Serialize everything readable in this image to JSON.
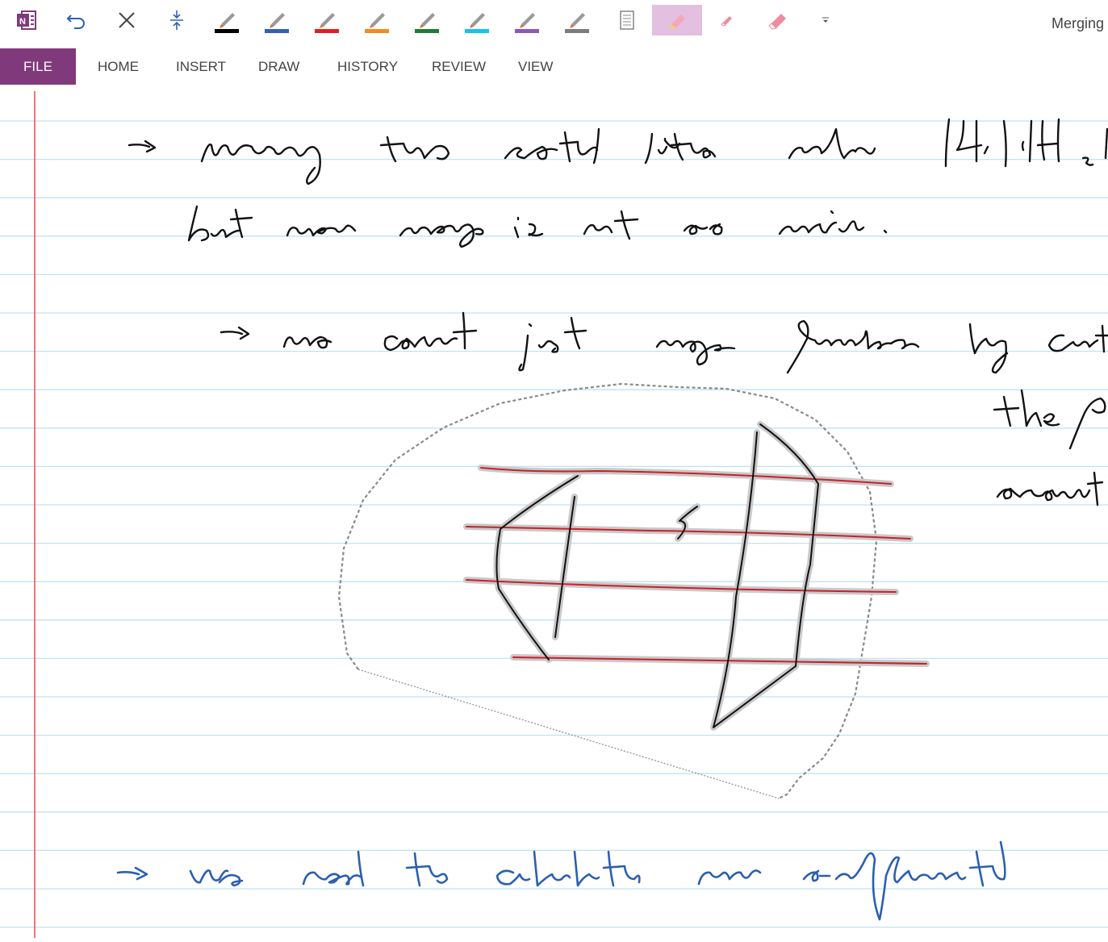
{
  "app": {
    "title": "Merging"
  },
  "quick_access": {
    "icons": [
      "onenote-logo-icon",
      "undo-icon",
      "lasso-delete-icon",
      "insert-space-icon",
      "pen-black-icon",
      "pen-blue-icon",
      "pen-red-icon",
      "pen-orange-icon",
      "pen-green-icon",
      "pen-cyan-icon",
      "pen-purple-icon",
      "pen-gray-icon",
      "page-icon",
      "highlighter-pink-icon",
      "eraser-small-icon",
      "eraser-large-icon",
      "customize-dropdown-icon"
    ],
    "pen_colors": [
      "#000000",
      "#2e62b4",
      "#e02020",
      "#f28c1c",
      "#1e7d36",
      "#12c4ef",
      "#8e56c0",
      "#7c7c7c"
    ],
    "active_tool": "highlighter-pink"
  },
  "ribbon": {
    "file_tab": "FILE",
    "tabs": [
      "HOME",
      "INSERT",
      "DRAW",
      "HISTORY",
      "REVIEW",
      "VIEW"
    ]
  },
  "colors": {
    "file_tab": "#80397b",
    "rule_line": "#bfe3f2",
    "margin_line": "#e84b4b",
    "ink_black": "#111111",
    "ink_blue": "#2b5fb0",
    "ink_red": "#c8202a",
    "selection_halo": "#c9c9c9",
    "lasso": "#8a8a8a"
  }
}
